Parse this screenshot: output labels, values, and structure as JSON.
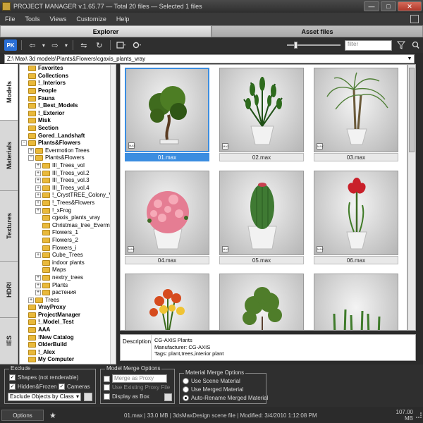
{
  "window": {
    "title": "PROJECT MANAGER v.1.65.77  —  Total 20 files  —  Selected 1 files",
    "minimize": "—",
    "maximize": "□",
    "close": "✕"
  },
  "menu": [
    "File",
    "Tools",
    "Views",
    "Customize",
    "Help"
  ],
  "tabs": {
    "explorer": "Explorer",
    "asset_files": "Asset files"
  },
  "toolbar": {
    "pk": "PK",
    "back": "⇦",
    "back_dd": "▾",
    "forward": "⇨",
    "forward_dd": "▾",
    "sync": "⇋",
    "refresh": "↻",
    "filter_placeholder": "filter",
    "filter_icon": "filter-icon",
    "search_icon": "search-icon"
  },
  "path": "Z:\\  Max\\  3d models\\Plants&Flowers\\cgaxis_plants_vray",
  "side_tabs": [
    "Models",
    "Materials",
    "Textures",
    "HDRI",
    "IES"
  ],
  "tree": [
    {
      "label": "Favorites",
      "bold": true,
      "level": 0,
      "expander": ""
    },
    {
      "label": "Collections",
      "bold": true,
      "level": 0,
      "expander": ""
    },
    {
      "label": "!_Interiors",
      "bold": true,
      "level": 0,
      "expander": ""
    },
    {
      "label": "People",
      "bold": true,
      "level": 0,
      "expander": ""
    },
    {
      "label": "Fauna",
      "bold": true,
      "level": 0,
      "expander": ""
    },
    {
      "label": "!_Best_Models",
      "bold": true,
      "level": 0,
      "expander": ""
    },
    {
      "label": "!_Exterior",
      "bold": true,
      "level": 0,
      "expander": ""
    },
    {
      "label": "Misk",
      "bold": true,
      "level": 0,
      "expander": ""
    },
    {
      "label": "Section",
      "bold": true,
      "level": 0,
      "expander": ""
    },
    {
      "label": "Gored_Landshaft",
      "bold": true,
      "level": 0,
      "expander": ""
    },
    {
      "label": "Plants&Flowers",
      "bold": true,
      "level": 0,
      "expander": "−"
    },
    {
      "label": "Evermotion Trees",
      "bold": false,
      "level": 1,
      "expander": "+"
    },
    {
      "label": "Plants&Flowers",
      "bold": false,
      "level": 1,
      "expander": "−"
    },
    {
      "label": "III_Trees_vol",
      "bold": false,
      "level": 2,
      "expander": "+"
    },
    {
      "label": "III_Trees_vol.2",
      "bold": false,
      "level": 2,
      "expander": "+"
    },
    {
      "label": "III_Trees_vol.3",
      "bold": false,
      "level": 2,
      "expander": "+"
    },
    {
      "label": "III_Trees_vol.4",
      "bold": false,
      "level": 2,
      "expander": "+"
    },
    {
      "label": "!_CrystTREE_Colony_VG",
      "bold": false,
      "level": 2,
      "expander": "+"
    },
    {
      "label": "!_Trees&Flowers",
      "bold": false,
      "level": 2,
      "expander": "+"
    },
    {
      "label": "!_xFrog",
      "bold": false,
      "level": 2,
      "expander": "+"
    },
    {
      "label": "cgaxis_plants_vray",
      "bold": false,
      "level": 2,
      "expander": ""
    },
    {
      "label": "Christmas_tree_Evermotion",
      "bold": false,
      "level": 2,
      "expander": ""
    },
    {
      "label": "Flowers_1",
      "bold": false,
      "level": 2,
      "expander": ""
    },
    {
      "label": "Flowers_2",
      "bold": false,
      "level": 2,
      "expander": ""
    },
    {
      "label": "Flowers_i",
      "bold": false,
      "level": 2,
      "expander": ""
    },
    {
      "label": "Cube_Trees",
      "bold": false,
      "level": 2,
      "expander": "+"
    },
    {
      "label": "indoor plants",
      "bold": false,
      "level": 2,
      "expander": ""
    },
    {
      "label": "Maps",
      "bold": false,
      "level": 2,
      "expander": ""
    },
    {
      "label": "nextry_trees",
      "bold": false,
      "level": 2,
      "expander": "+"
    },
    {
      "label": "Plants",
      "bold": false,
      "level": 2,
      "expander": "+"
    },
    {
      "label": "растения",
      "bold": false,
      "level": 2,
      "expander": "+"
    },
    {
      "label": "Trees",
      "bold": false,
      "level": 1,
      "expander": "+"
    },
    {
      "label": "VrayProxy",
      "bold": true,
      "level": 0,
      "expander": ""
    },
    {
      "label": "ProjectManager",
      "bold": true,
      "level": 0,
      "expander": ""
    },
    {
      "label": "!_Model_Test",
      "bold": true,
      "level": 0,
      "expander": ""
    },
    {
      "label": "AAA",
      "bold": true,
      "level": 0,
      "expander": ""
    },
    {
      "label": "!New Catalog",
      "bold": true,
      "level": 0,
      "expander": ""
    },
    {
      "label": "OlderBuild",
      "bold": true,
      "level": 0,
      "expander": ""
    },
    {
      "label": "!_Alex",
      "bold": true,
      "level": 0,
      "expander": ""
    },
    {
      "label": "My Computer",
      "bold": true,
      "level": 0,
      "expander": ""
    }
  ],
  "files": [
    {
      "name": "01.max",
      "plant": "bonsai",
      "selected": true
    },
    {
      "name": "02.max",
      "plant": "zamioculcas",
      "selected": false
    },
    {
      "name": "03.max",
      "plant": "palm",
      "selected": false
    },
    {
      "name": "04.max",
      "plant": "azalea",
      "selected": false
    },
    {
      "name": "05.max",
      "plant": "cactus",
      "selected": false
    },
    {
      "name": "06.max",
      "plant": "amaryllis",
      "selected": false
    },
    {
      "name": "",
      "plant": "lilies",
      "selected": false
    },
    {
      "name": "",
      "plant": "bush",
      "selected": false
    },
    {
      "name": "",
      "plant": "grass",
      "selected": false
    }
  ],
  "badge": "MAX",
  "description": {
    "label": "Description",
    "lines": [
      "CG-AXIS Plants",
      "Manufacturer: CG-AXIS",
      "Tags: plant,trees,interior plant"
    ]
  },
  "exclude": {
    "legend": "Exclude",
    "shapes": "Shapes (not renderable)",
    "hidden": "Hidden&Frozen",
    "cameras": "Cameras",
    "exclude_by": "Exclude Objects by Class",
    "check": "✓"
  },
  "model_merge": {
    "legend": "Model Merge Options",
    "merge_as": "Merge as Proxy",
    "use_existing": "Use Existing Proxy File",
    "display_as": "Display as Box"
  },
  "material_merge": {
    "legend": "Material Merge Options",
    "options": [
      "Use Scene Material",
      "Use Merged Material",
      "Auto-Rename Merged Material"
    ],
    "selected_index": 2
  },
  "status": {
    "options": "Options",
    "star": "★",
    "text": "01.max  |  33.0 MB  |  3dsMaxDesign scene file  |  Modified: 3/4/2010 1:12:08 PM",
    "memory": "107.00 MB"
  }
}
